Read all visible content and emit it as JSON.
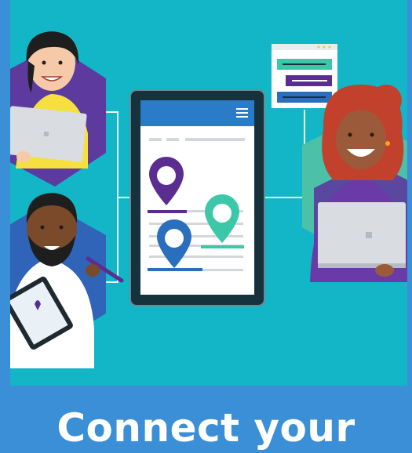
{
  "headline": "Connect your",
  "colors": {
    "background": "#3b8fd6",
    "panel": "#13b6c6",
    "tablet_frame": "#16323c",
    "tablet_header": "#2a7cc9",
    "pin_purple": "#5c2d91",
    "pin_teal": "#3cc8a8",
    "pin_blue": "#2a6ebe",
    "text": "#ffffff"
  },
  "icons": [
    "hamburger-menu-icon",
    "map-pin-icon",
    "laptop-icon",
    "tablet-icon",
    "stylus-icon"
  ]
}
